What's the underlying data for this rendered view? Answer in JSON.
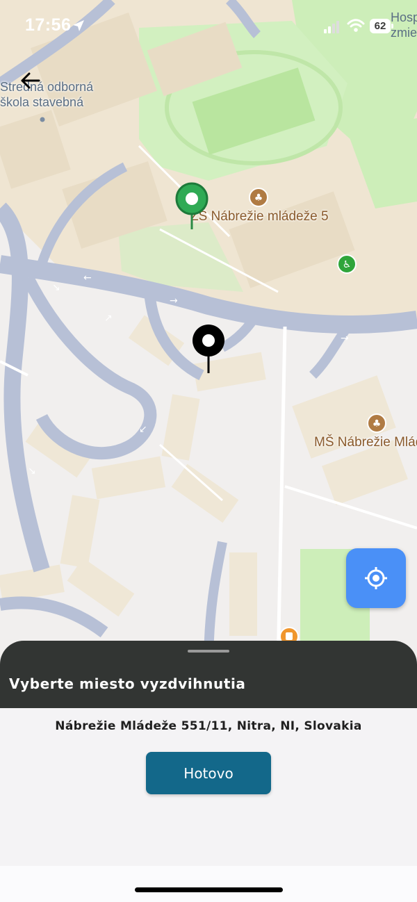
{
  "status_bar": {
    "time": "17:56",
    "battery": "62",
    "icons": [
      "location-arrow-icon",
      "signal-icon",
      "wifi-icon",
      "battery-icon"
    ]
  },
  "navigation": {
    "back_icon": "arrow-left-icon"
  },
  "map": {
    "labels": {
      "school_line1": "Stredná odborná",
      "school_line2": "škola stavebná",
      "zs": "ZŠ Nábrežie mládeže 5",
      "ms": "MŠ Nábrežie Mlád",
      "hosp_line1": "Hosp",
      "hosp_line2": "zmie"
    },
    "markers": [
      "green-pin-icon",
      "black-pin-icon",
      "school-poi-icon",
      "accessibility-poi-icon",
      "cafe-poi-icon"
    ],
    "colors": {
      "road": "#b7c0d6",
      "land": "#f1ece4",
      "built": "#efe4d0",
      "park": "#cdeeb9",
      "green_pin": "#2faa54",
      "black_pin": "#000000",
      "poi": "#b07b43"
    }
  },
  "gps_button": {
    "icon": "gps-target-icon",
    "color": "#4a90f7"
  },
  "sheet": {
    "title": "Vyberte miesto vyzdvihnutia",
    "address": "Nábrežie Mládeže 551/11, Nitra, NI, Slovakia",
    "done_label": "Hotovo",
    "colors": {
      "header": "#323533",
      "button": "#13688a"
    }
  }
}
